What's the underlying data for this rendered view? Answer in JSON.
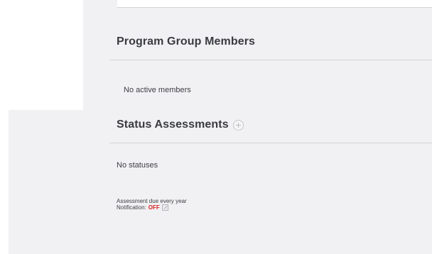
{
  "program_group": {
    "title": "Program Group Members",
    "empty_text": "No active members"
  },
  "status_assessments": {
    "title": "Status Assessments",
    "add_icon": "plus-circle-icon",
    "empty_text": "No statuses",
    "due_text": "Assessment due every year",
    "notification_label": "Notification:",
    "notification_value": "OFF",
    "edit_icon": "edit-icon",
    "notification_color": "#d62222"
  }
}
